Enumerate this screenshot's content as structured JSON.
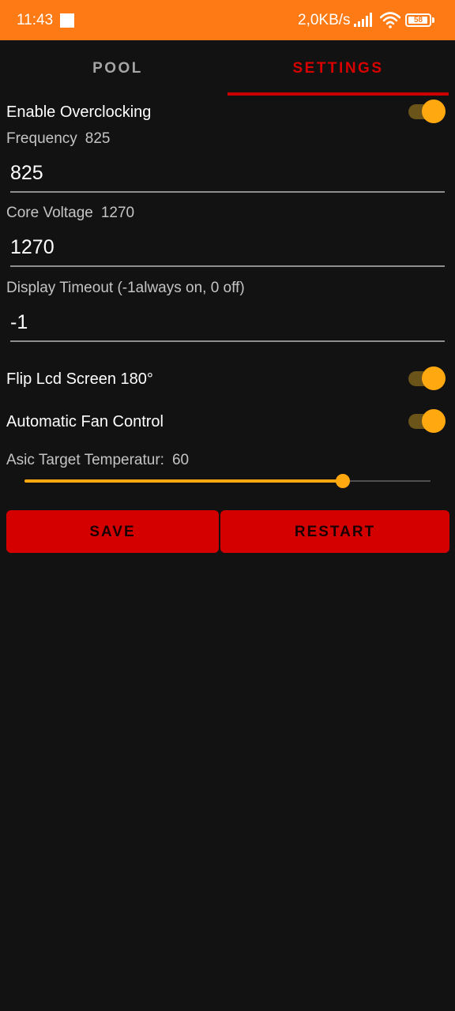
{
  "status_bar": {
    "time": "11:43",
    "net_speed": "2,0KB/s",
    "battery": "58"
  },
  "tabs": [
    {
      "label": "POOL",
      "active": false
    },
    {
      "label": "SETTINGS",
      "active": true
    }
  ],
  "settings": {
    "enable_overclocking": {
      "label": "Enable Overclocking",
      "on": true
    },
    "frequency": {
      "label": "Frequency",
      "current": "825",
      "value": "825"
    },
    "core_voltage": {
      "label": "Core Voltage",
      "current": "1270",
      "value": "1270"
    },
    "display_timeout": {
      "label": "Display Timeout (-1always on, 0 off)",
      "value": "-1"
    },
    "flip_lcd": {
      "label": "Flip Lcd Screen 180°",
      "on": true
    },
    "auto_fan": {
      "label": "Automatic Fan Control",
      "on": true
    },
    "asic_target_temp": {
      "label": "Asic Target Temperatur:",
      "value": "60",
      "fraction": 0.785
    }
  },
  "buttons": {
    "save_label": "SAVE",
    "restart_label": "RESTART"
  },
  "colors": {
    "status_bar": "#fe7a15",
    "background": "#121212",
    "accent_red": "#d40000",
    "toggle_on": "#ffa80f"
  }
}
